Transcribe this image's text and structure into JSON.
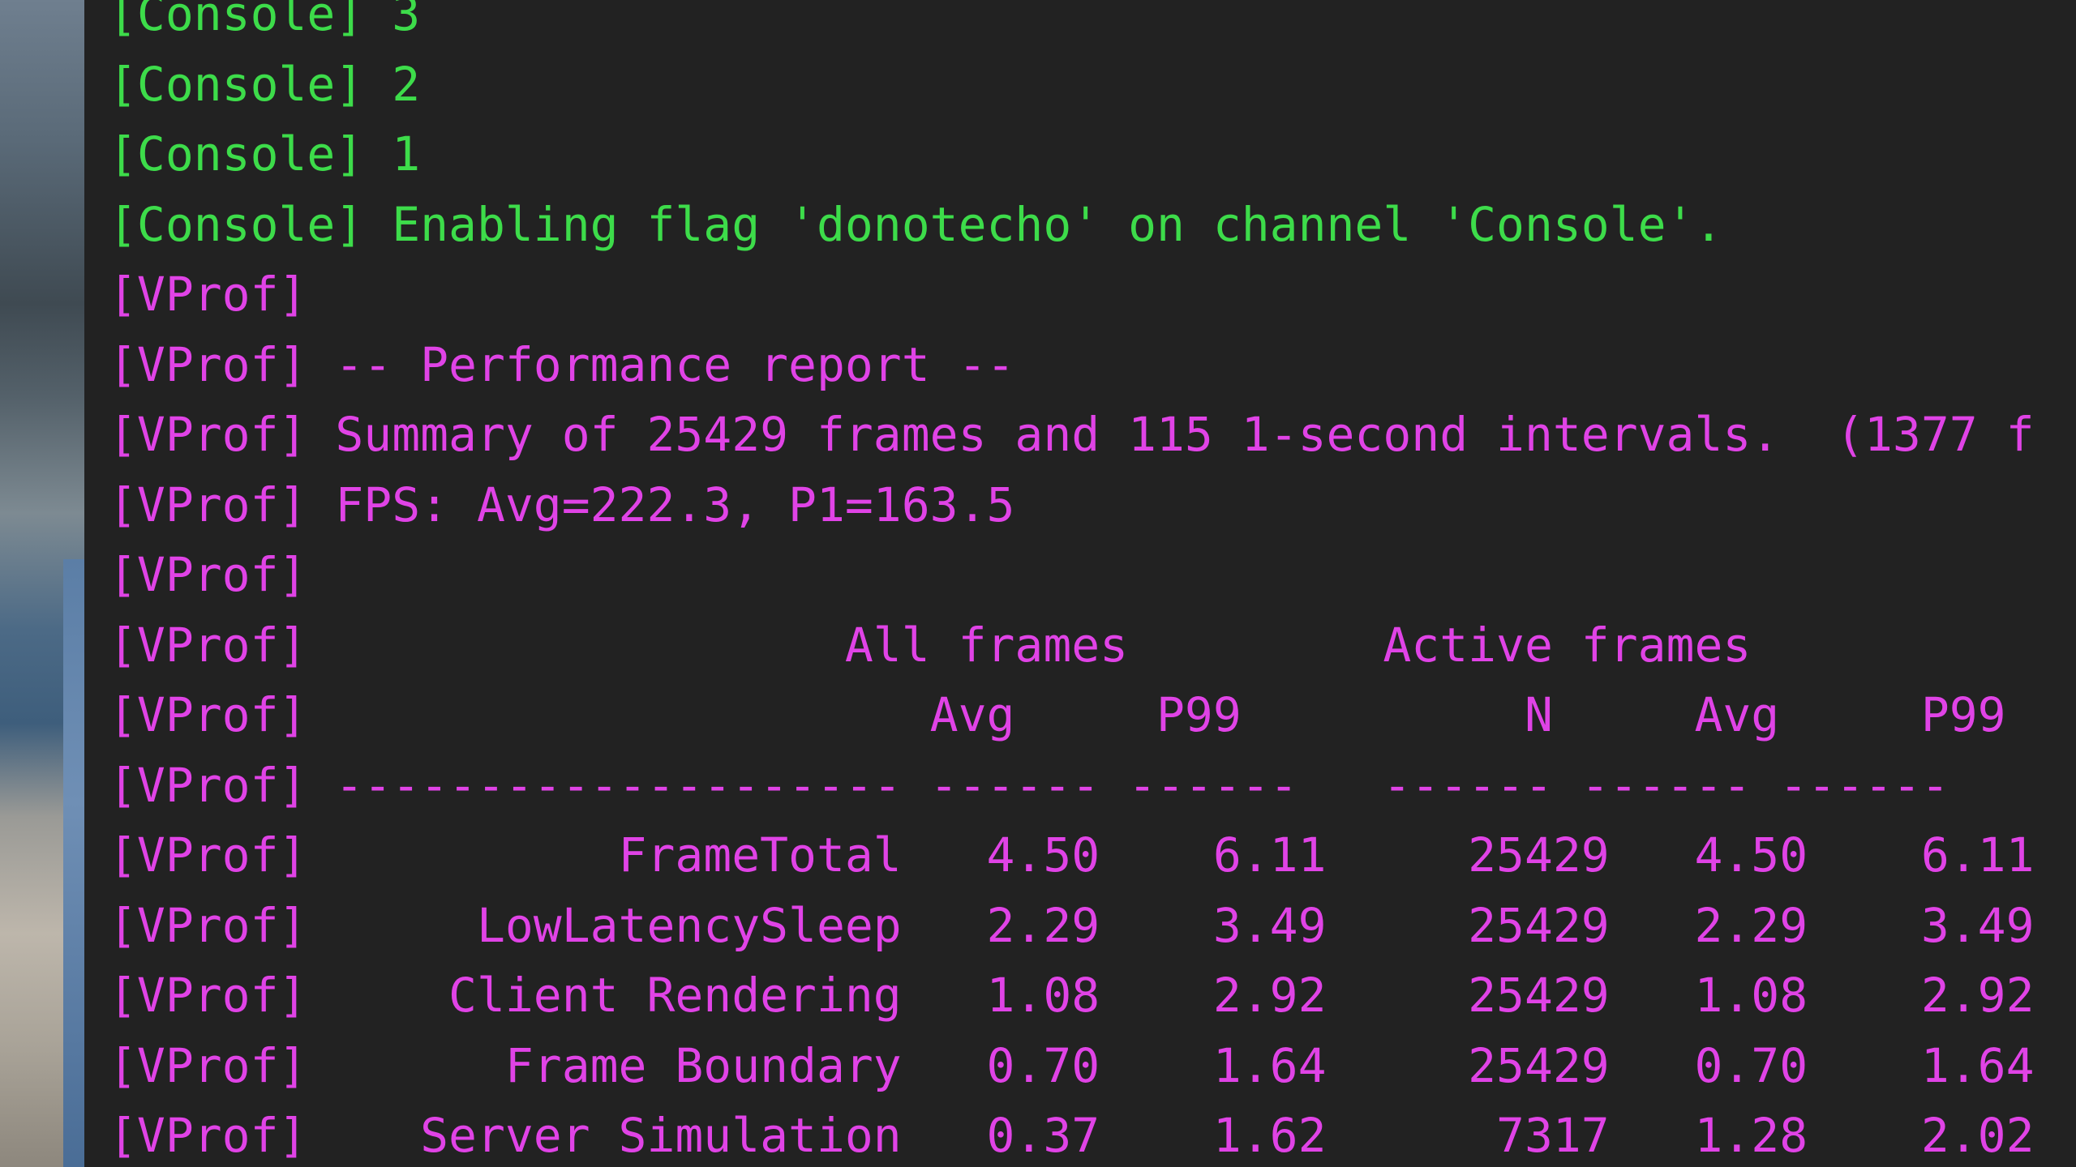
{
  "colors": {
    "console_bg": "#222222",
    "console_channel": "#3ddc4a",
    "vprof_channel": "#e043e6"
  },
  "console": {
    "lines": [
      {
        "text": "[Console] 3",
        "color": "green"
      },
      {
        "text": "[Console] 2",
        "color": "green"
      },
      {
        "text": "[Console] 1",
        "color": "green"
      },
      {
        "text": "[Console] Enabling flag 'donotecho' on channel 'Console'.",
        "color": "green"
      },
      {
        "text": "[VProf]",
        "color": "magenta"
      },
      {
        "text": "[VProf] -- Performance report --",
        "color": "magenta"
      },
      {
        "text": "[VProf] Summary of 25429 frames and 115 1-second intervals.  (1377 f",
        "color": "magenta"
      },
      {
        "text": "[VProf] FPS: Avg=222.3, P1=163.5",
        "color": "magenta"
      },
      {
        "text": "[VProf]",
        "color": "magenta"
      },
      {
        "text": "[VProf]                   All frames         Active frames",
        "color": "magenta"
      },
      {
        "text": "[VProf]                      Avg     P99          N     Avg     P99",
        "color": "magenta"
      },
      {
        "text": "[VProf] -------------------- ------ ------   ------ ------ ------",
        "color": "magenta"
      },
      {
        "text": "[VProf]           FrameTotal   4.50    6.11     25429   4.50    6.11",
        "color": "magenta"
      },
      {
        "text": "[VProf]      LowLatencySleep   2.29    3.49     25429   2.29    3.49",
        "color": "magenta"
      },
      {
        "text": "[VProf]     Client Rendering   1.08    2.92     25429   1.08    2.92",
        "color": "magenta"
      },
      {
        "text": "[VProf]       Frame Boundary   0.70    1.64     25429   0.70    1.64",
        "color": "magenta"
      },
      {
        "text": "[VProf]    Server Simulation   0.37    1.62      7317   1.28    2.02",
        "color": "magenta"
      }
    ]
  }
}
